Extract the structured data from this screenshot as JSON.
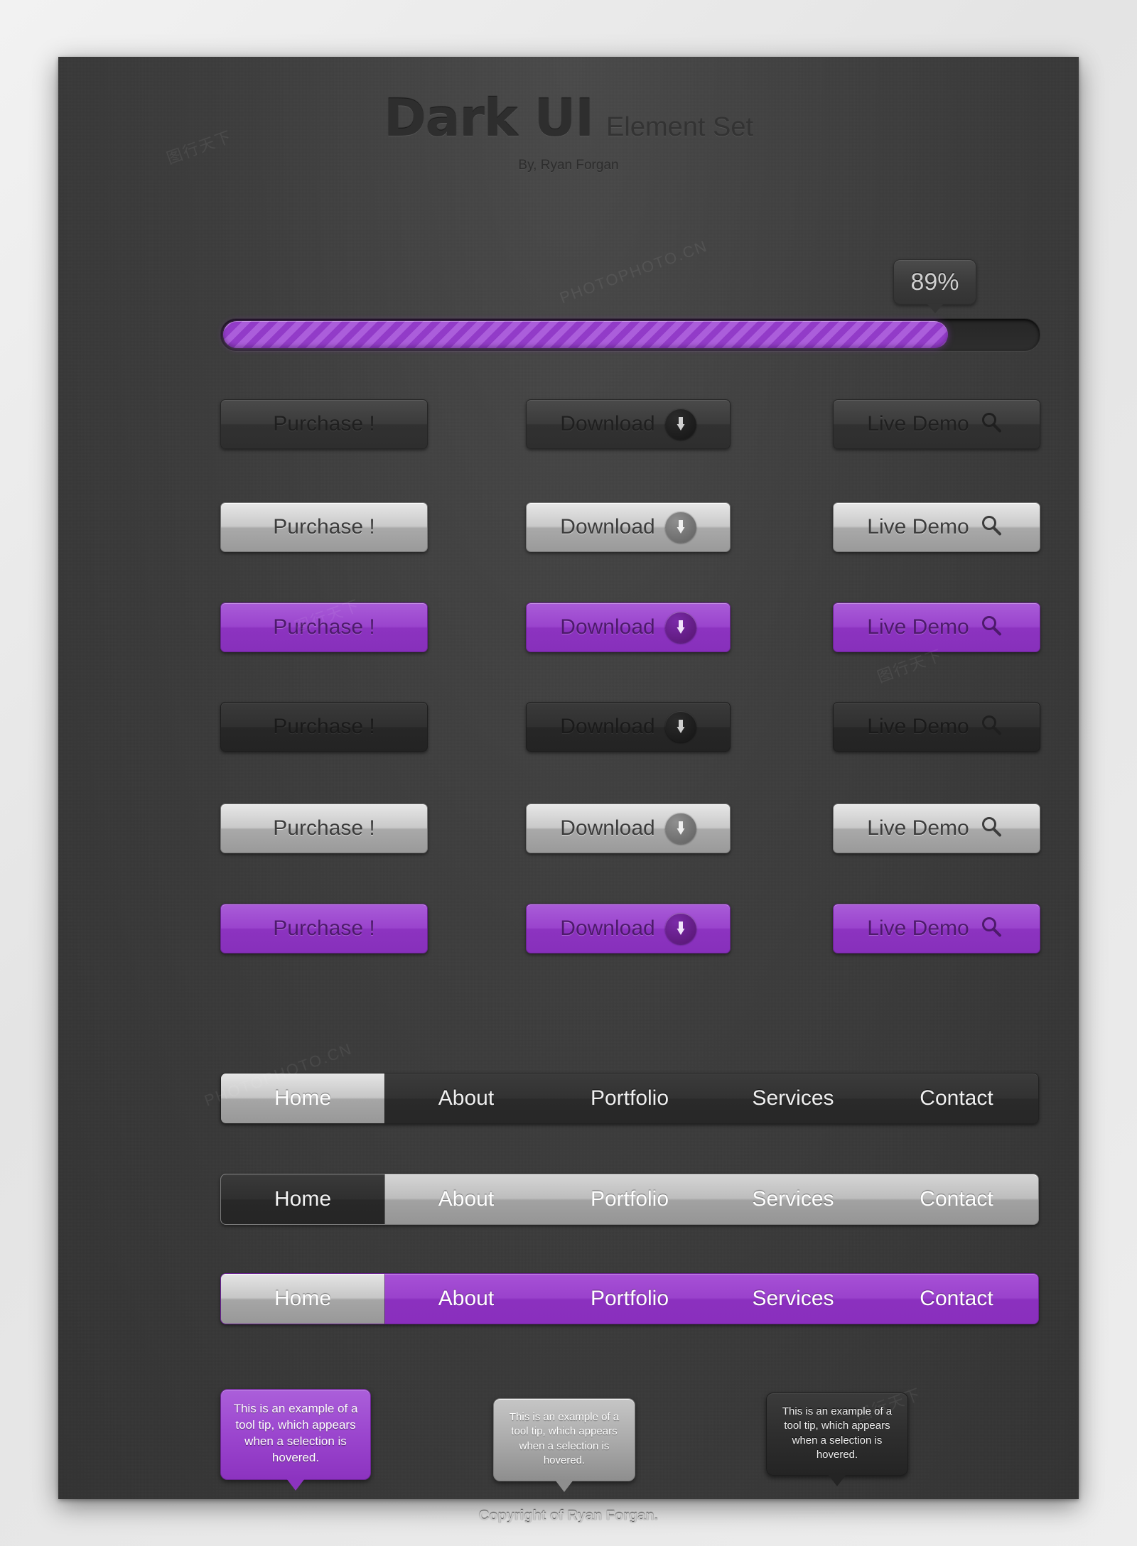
{
  "header": {
    "title_main": "Dark UI",
    "title_sub": "Element Set",
    "byline": "By, Ryan Forgan"
  },
  "progress": {
    "badge_label": "89%",
    "percent": 89,
    "fill_color": "#9b3fd4",
    "track_color": "#2a2a2a"
  },
  "buttons": {
    "labels": {
      "purchase": "Purchase !",
      "download": "Download",
      "live_demo": "Live Demo"
    },
    "icons": {
      "download": "download-arrow-circle-icon",
      "live_demo": "magnifier-icon"
    },
    "rows": [
      {
        "style": "dark",
        "state": "normal"
      },
      {
        "style": "silver",
        "state": "normal"
      },
      {
        "style": "purple",
        "state": "normal"
      },
      {
        "style": "dark2",
        "state": "pressed"
      },
      {
        "style": "silver",
        "state": "pressed"
      },
      {
        "style": "purple",
        "state": "pressed"
      }
    ]
  },
  "navbars": {
    "items": [
      "Home",
      "About",
      "Portfolio",
      "Services",
      "Contact"
    ],
    "bars": [
      {
        "style": "dark",
        "active_index": 0,
        "active_style": "active-silver"
      },
      {
        "style": "silver",
        "active_index": 0,
        "active_style": "active-dark"
      },
      {
        "style": "purple",
        "active_index": 0,
        "active_style": "active-silver"
      }
    ]
  },
  "tooltips": {
    "text": "This is an example of a tool tip, which appears when a selection is hovered.",
    "variants": [
      "purple",
      "silver",
      "dark"
    ]
  },
  "footer": {
    "copyright": "Copyright of Ryan Forgan."
  },
  "colors": {
    "accent_purple": "#9a44cd",
    "sheet_bg": "#3e3e3e",
    "page_bg": "#e8e8e8"
  }
}
